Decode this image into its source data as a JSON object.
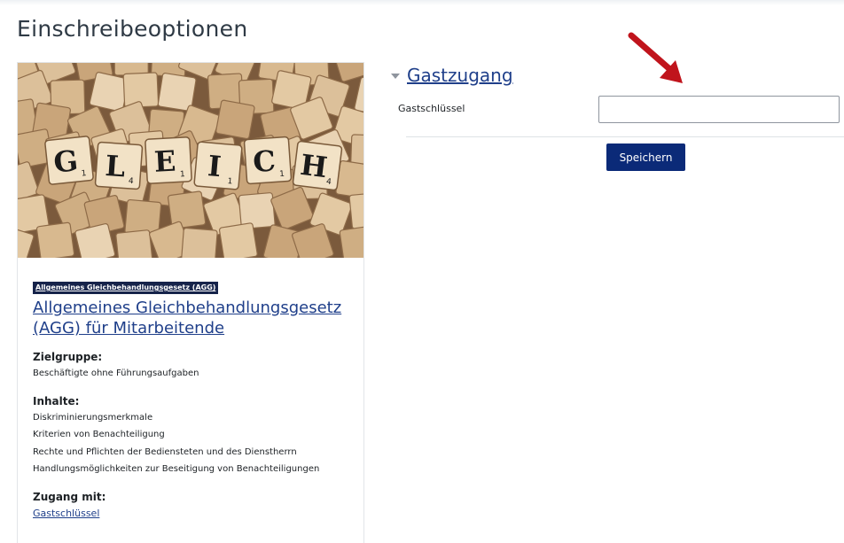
{
  "page": {
    "title": "Einschreibeoptionen"
  },
  "course": {
    "category": "Allgemeines Gleichbehandlungsgesetz (AGG)",
    "name": "Allgemeines Gleichbehandlungsgesetz (AGG) für Mitarbeitende",
    "image_letters": [
      "G",
      "L",
      "E",
      "I",
      "C",
      "H"
    ],
    "image_scores": [
      "1",
      "4",
      "1",
      "1",
      "1",
      "4"
    ],
    "target_group_heading": "Zielgruppe:",
    "target_group": "Beschäftigte ohne Führungsaufgaben",
    "contents_heading": "Inhalte:",
    "contents": [
      "Diskriminierungsmerkmale",
      "Kriterien von Benachteiligung",
      "Rechte und Pflichten der Bediensteten und des Dienstherrn",
      "Handlungsmöglichkeiten zur Beseitigung von Benachteiligungen"
    ],
    "access_heading": "Zugang mit:",
    "access_method": "Gastschlüssel"
  },
  "enrol_form": {
    "section_title": "Gastzugang",
    "field_label": "Gastschlüssel",
    "field_value": "",
    "save_label": "Speichern"
  },
  "colors": {
    "link": "#1f3f8a",
    "primary_button": "#0b2a78",
    "badge": "#16234a",
    "annotation_arrow": "#c0141c"
  }
}
